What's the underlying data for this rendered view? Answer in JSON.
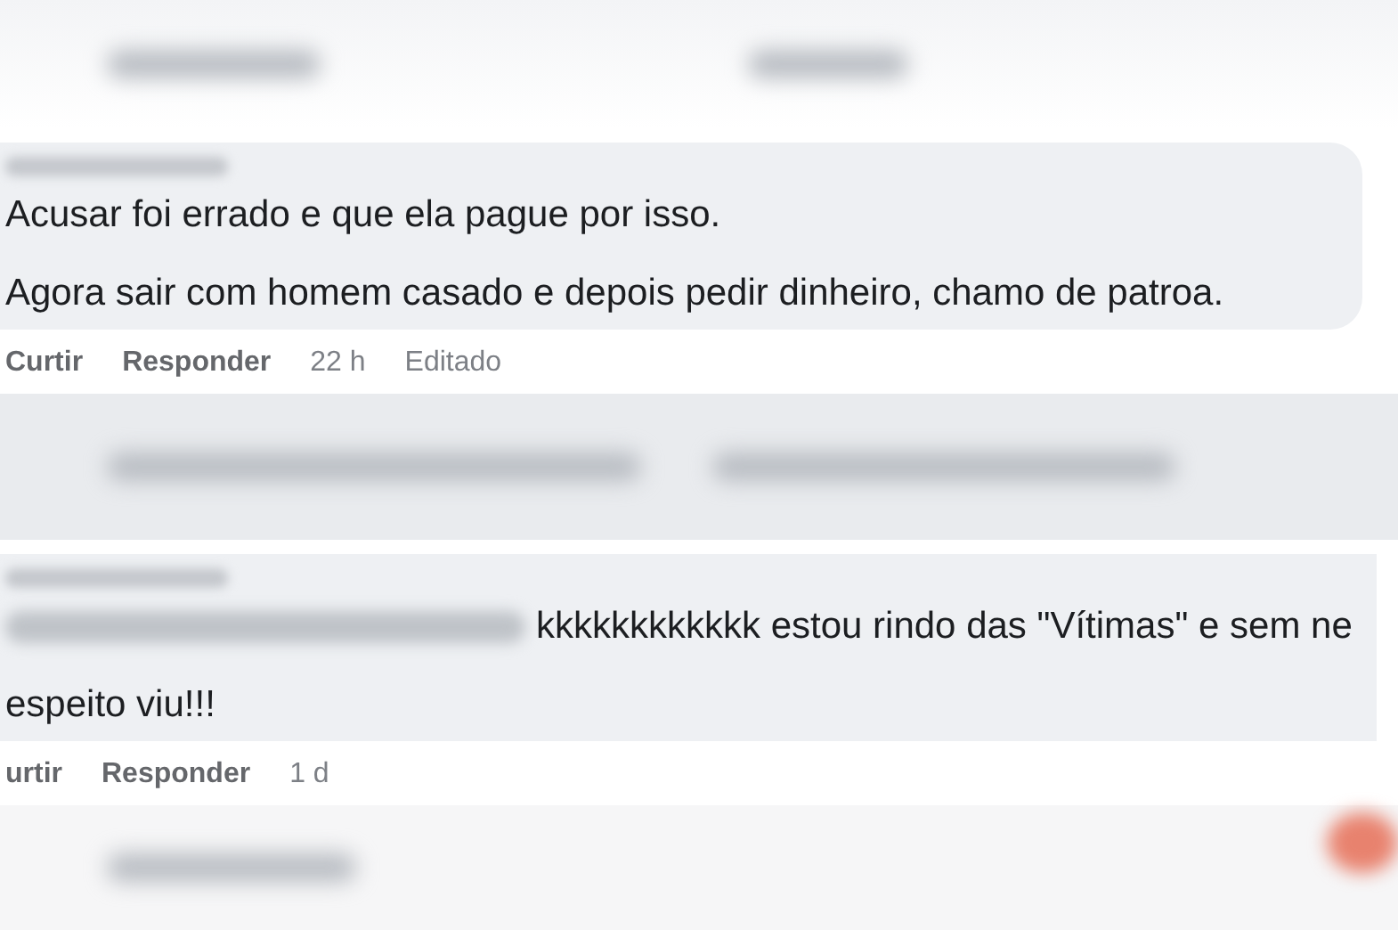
{
  "comments": [
    {
      "lines": [
        "Acusar foi errado e que ela pague por isso.",
        "Agora sair com homem casado e depois pedir dinheiro, chamo de patroa."
      ],
      "actions": [
        "Curtir",
        "Responder"
      ],
      "time": "22 h",
      "edited": "Editado",
      "blurred_lead": false
    },
    {
      "lines": [
        "kkkkkkkkkkkk estou rindo das \"Vítimas\" e sem ne",
        "espeito viu!!!"
      ],
      "actions": [
        "urtir",
        "Responder"
      ],
      "time": "1 d",
      "blurred_lead": true
    }
  ]
}
